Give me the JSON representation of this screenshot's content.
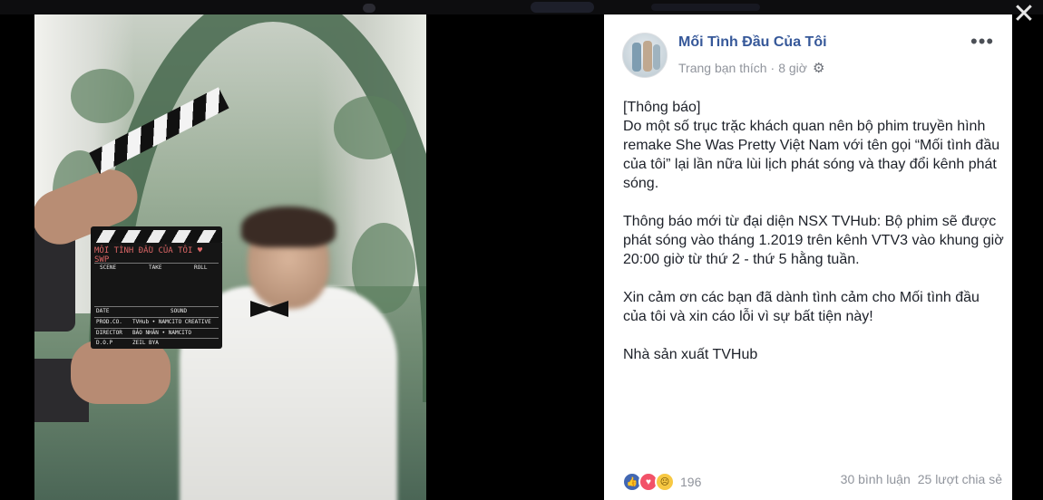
{
  "post": {
    "page_name": "Mối Tình Đầu Của Tôi",
    "meta_label": "Trang bạn thích",
    "separator": "·",
    "time": "8 giờ",
    "paragraphs": [
      "[Thông báo]\nDo một số trục trặc khách quan nên bộ phim truyền hình remake She Was Pretty Việt Nam với tên gọi “Mối tình đầu của tôi” lại lần nữa lùi lịch phát sóng và thay đổi kênh phát sóng.",
      "Thông báo mới từ đại diện NSX TVHub: Bộ phim sẽ được phát sóng vào tháng 1.2019 trên kênh VTV3 vào khung giờ 20:00 giờ từ thứ 2 - thứ 5 hằng tuần.",
      "Xin cảm ơn các bạn đã dành tình cảm cho Mối tình đầu của tôi và xin cáo lỗi vì sự bất tiện này!",
      "Nhà sản xuất TVHub"
    ],
    "reactions": {
      "icons": [
        "like-icon",
        "love-icon",
        "sad-icon"
      ],
      "count": "196"
    },
    "comments": "30 bình luận",
    "shares": "25 lượt chia sẻ"
  },
  "photo": {
    "clapper_title": "MỐI TÌNH ĐẦU CỦA TÔI ♥ SWP",
    "scene_label": "SCENE",
    "take_label": "TAKE",
    "roll_label": "ROLL",
    "date_label": "DATE",
    "sound_label": "SOUND",
    "prod_label": "PROD.CO.",
    "prod_value": "TVHub • NAMCITO CREATIVE",
    "director_label": "DIRECTOR",
    "director_value": "BẢO NHÂN • NAMCITO",
    "dop_label": "D.O.P",
    "dop_value": "ZEIL BYA"
  },
  "colors": {
    "link_blue": "#365899",
    "meta_gray": "#90949c",
    "text": "#1d2129"
  }
}
